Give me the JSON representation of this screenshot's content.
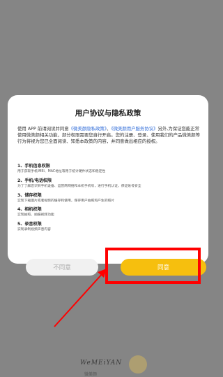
{
  "dialog": {
    "title": "用户协议与隐私政策",
    "intro_prefix": "使用 APP 前请阅读并同意",
    "privacy_link": "《微美颜隐私政策》",
    "sep": "、",
    "service_link": "《微美颜用户服务协议》",
    "intro_suffix": "另外,为保证您能正常使用微美颜相关功能，部分权限需要您自行开启。您的注册、登录、使用我们的产品微美颜等行为将视为您已全面阅读、知悉本政策的内容，并同意做出相应的授权。",
    "permissions": [
      {
        "title": "1、手机信息权限",
        "desc": "用于获取手机IMEI、MAC地址等用于统计硬件状态和稳定性"
      },
      {
        "title": "2、手机/电话权限",
        "desc": "为了了解您识到手机设备、运营商网络和本机手机号，进行手机认证，保证账号安全"
      },
      {
        "title": "3、储存权限",
        "desc": "实现下载图片或者视频的缓存和使用，保存用户拍照和产生的照片"
      },
      {
        "title": "4、相机权限",
        "desc": "实现拍照、拍摄视频功能"
      },
      {
        "title": "5、录音权限",
        "desc": "实现录制视频声音内容"
      }
    ],
    "disagree_label": "不同意",
    "agree_label": "同意"
  },
  "logo": {
    "text": "WeMEiYAN",
    "sub": "微美颜"
  },
  "colors": {
    "overlay": "#858585",
    "accent": "#f6bf0e",
    "link": "#2e6bd8",
    "annotation": "#ff0000"
  }
}
